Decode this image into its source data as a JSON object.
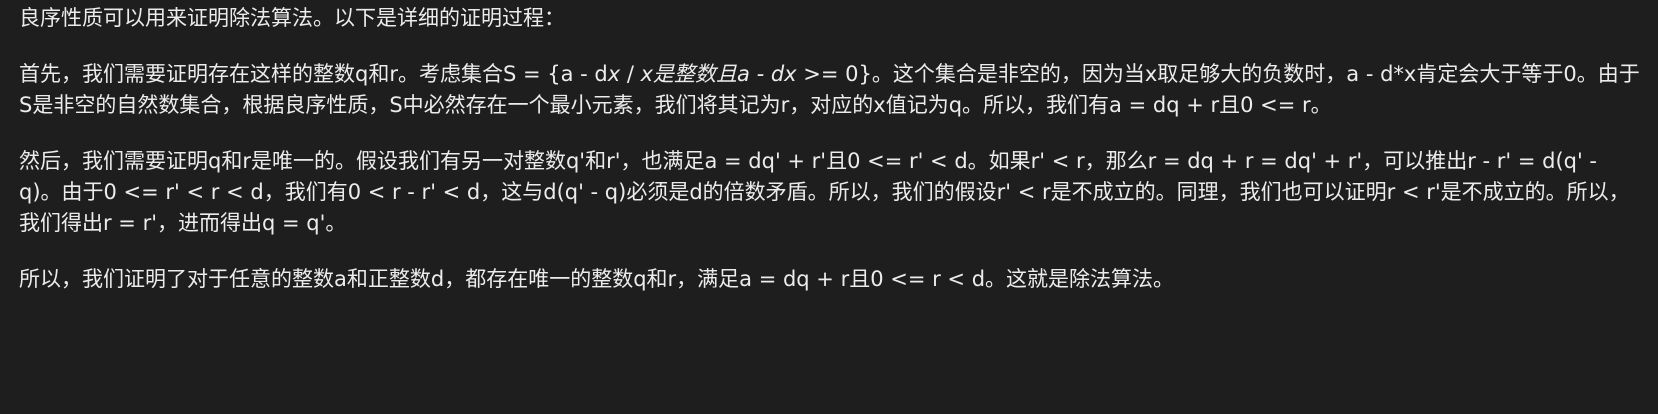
{
  "document": {
    "intro": "良序性质可以用来证明除法算法。以下是详细的证明过程：",
    "existence": {
      "part1": "首先，我们需要证明存在这样的整数q和r。考虑集合S = {a - d",
      "italic1": "x",
      "part2": " / ",
      "italic2": "x是整数且a - dx",
      "part3": " >= 0}。这个集合是非空的，因为当x取足够大的负数时，a - d*x肯定会大于等于0。由于S是非空的自然数集合，根据良序性质，S中必然存在一个最小元素，我们将其记为r，对应的x值记为q。所以，我们有a = dq + r且0 <= r。"
    },
    "uniqueness": "然后，我们需要证明q和r是唯一的。假设我们有另一对整数q'和r'，也满足a = dq' + r'且0 <= r' < d。如果r' < r，那么r = dq + r = dq' + r'，可以推出r - r' = d(q' - q)。由于0 <= r' < r < d，我们有0 < r - r' < d，这与d(q' - q)必须是d的倍数矛盾。所以，我们的假设r' < r是不成立的。同理，我们也可以证明r < r'是不成立的。所以，我们得出r = r'，进而得出q = q'。",
    "conclusion": "所以，我们证明了对于任意的整数a和正整数d，都存在唯一的整数q和r，满足a = dq + r且0 <= r < d。这就是除法算法。"
  }
}
